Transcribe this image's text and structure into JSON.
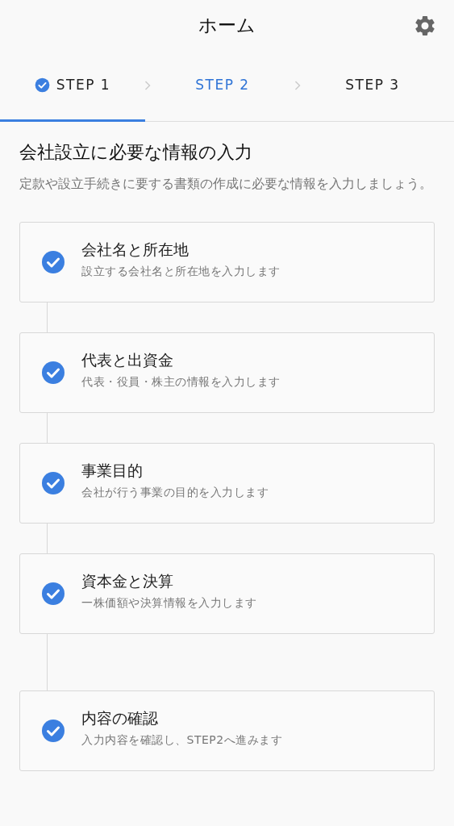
{
  "header": {
    "title": "ホーム"
  },
  "steps": [
    {
      "label": "STEP 1",
      "selected": true,
      "completed": true,
      "current": false
    },
    {
      "label": "STEP 2",
      "selected": false,
      "completed": false,
      "current": true
    },
    {
      "label": "STEP 3",
      "selected": false,
      "completed": false,
      "current": false
    }
  ],
  "section": {
    "title": "会社設立に必要な情報の入力",
    "description": "定款や設立手続きに要する書類の作成に必要な情報を入力しましょう。"
  },
  "tasks": [
    {
      "title": "会社名と所在地",
      "subtitle": "設立する会社名と所在地を入力します",
      "completed": true
    },
    {
      "title": "代表と出資金",
      "subtitle": "代表・役員・株主の情報を入力します",
      "completed": true
    },
    {
      "title": "事業目的",
      "subtitle": "会社が行う事業の目的を入力します",
      "completed": true
    },
    {
      "title": "資本金と決算",
      "subtitle": "一株価額や決算情報を入力します",
      "completed": true
    },
    {
      "title": "内容の確認",
      "subtitle": "入力内容を確認し、STEP2へ進みます",
      "completed": true
    }
  ]
}
